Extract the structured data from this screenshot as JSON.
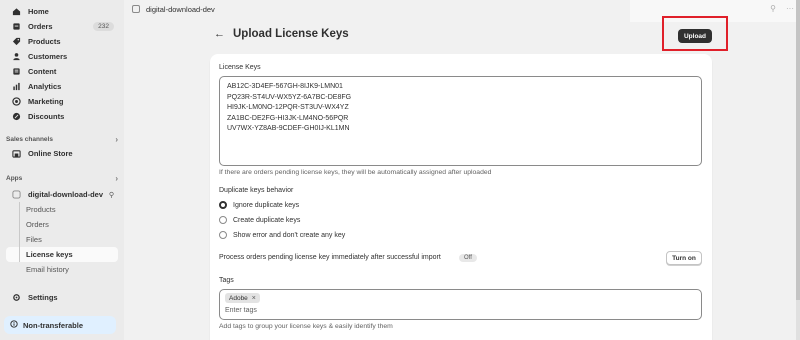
{
  "sidebar": {
    "nav": [
      {
        "label": "Home",
        "icon": "home-icon"
      },
      {
        "label": "Orders",
        "icon": "orders-icon",
        "count": "232"
      },
      {
        "label": "Products",
        "icon": "products-icon"
      },
      {
        "label": "Customers",
        "icon": "customers-icon"
      },
      {
        "label": "Content",
        "icon": "content-icon"
      },
      {
        "label": "Analytics",
        "icon": "analytics-icon"
      },
      {
        "label": "Marketing",
        "icon": "marketing-icon"
      },
      {
        "label": "Discounts",
        "icon": "discounts-icon"
      }
    ],
    "sales_channels_label": "Sales channels",
    "online_store_label": "Online Store",
    "apps_label": "Apps",
    "app_name": "digital-download-dev",
    "app_subitems": [
      "Products",
      "Orders",
      "Files",
      "License keys",
      "Email history"
    ],
    "active_subitem": "License keys",
    "settings_label": "Settings",
    "nontransferable_label": "Non-transferable"
  },
  "topbar": {
    "app_title": "digital-download-dev"
  },
  "page": {
    "title": "Upload License Keys",
    "upload_label": "Upload",
    "license_keys_label": "License Keys",
    "license_keys": [
      "AB12C-3D4EF-567GH-8IJK9-LMN01",
      "PQ23R-ST4UV-WX5YZ-6A7BC-DE8FG",
      "HI9JK-LM0NO-12PQR-ST3UV-WX4YZ",
      "ZA1BC-DE2FG-HI3JK-LM4NO-56PQR",
      "UV7WX-YZ8AB-9CDEF-GH0IJ-KL1MN"
    ],
    "license_keys_help": "If there are orders pending license keys, they will be automatically assigned after uploaded",
    "duplicate_label": "Duplicate keys behavior",
    "duplicate_options": [
      "Ignore duplicate keys",
      "Create duplicate keys",
      "Show error and don't create any key"
    ],
    "duplicate_selected": "Ignore duplicate keys",
    "process_label": "Process orders pending license key immediately after successful import",
    "process_status": "Off",
    "turn_on_label": "Turn on",
    "tags_label": "Tags",
    "tags": [
      "Adobe"
    ],
    "tags_placeholder": "Enter tags",
    "tags_help": "Add tags to group your license keys & easily identify them"
  },
  "colors": {
    "sidebar_bg": "#ebebeb",
    "page_bg": "#f1f1f1",
    "primary_button": "#303030",
    "highlight_border": "#e0202a",
    "nontransferable_bg": "#e0f0ff"
  }
}
